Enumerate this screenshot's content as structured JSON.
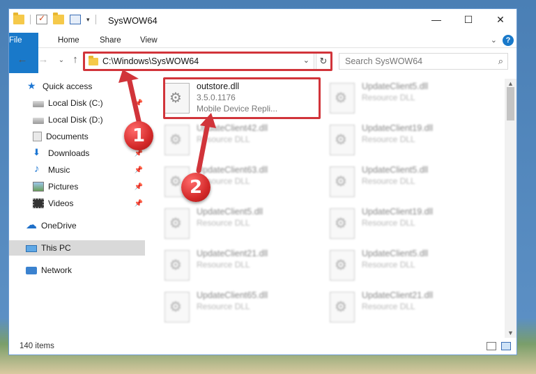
{
  "window": {
    "title": "SysWOW64"
  },
  "ribbon": {
    "tabs": [
      "File",
      "Home",
      "Share",
      "View"
    ]
  },
  "address": {
    "path": "C:\\Windows\\SysWOW64"
  },
  "search": {
    "placeholder": "Search SysWOW64"
  },
  "sidebar": {
    "items": [
      {
        "label": "Quick access",
        "icon": "star-icon"
      },
      {
        "label": "Local Disk (C:)",
        "icon": "disk-icon"
      },
      {
        "label": "Local Disk (D:)",
        "icon": "disk-icon"
      },
      {
        "label": "Documents",
        "icon": "documents-icon"
      },
      {
        "label": "Downloads",
        "icon": "download-icon"
      },
      {
        "label": "Music",
        "icon": "music-icon"
      },
      {
        "label": "Pictures",
        "icon": "pictures-icon"
      },
      {
        "label": "Videos",
        "icon": "videos-icon"
      },
      {
        "label": "OneDrive",
        "icon": "cloud-icon"
      },
      {
        "label": "This PC",
        "icon": "pc-icon"
      },
      {
        "label": "Network",
        "icon": "network-icon"
      }
    ]
  },
  "files": {
    "highlighted": {
      "name": "outstore.dll",
      "version": "3.5.0.1176",
      "description": "Mobile Device Repli..."
    },
    "others": [
      {
        "name": "UpdateClient5.dll",
        "type": "Resource DLL"
      },
      {
        "name": "UpdateClient42.dll",
        "type": "Resource DLL"
      },
      {
        "name": "UpdateClient19.dll",
        "type": "Resource DLL"
      },
      {
        "name": "UpdateClient63.dll",
        "type": "Resource DLL"
      },
      {
        "name": "UpdateClient5.dll",
        "type": "Resource DLL"
      },
      {
        "name": "UpdateClient5.dll",
        "type": "Resource DLL"
      },
      {
        "name": "UpdateClient19.dll",
        "type": "Resource DLL"
      },
      {
        "name": "UpdateClient21.dll",
        "type": "Resource DLL"
      },
      {
        "name": "UpdateClient5.dll",
        "type": "Resource DLL"
      },
      {
        "name": "UpdateClient65.dll",
        "type": "Resource DLL"
      },
      {
        "name": "UpdateClient21.dll",
        "type": "Resource DLL"
      }
    ]
  },
  "status": {
    "count": "140 items"
  },
  "annotations": {
    "marker1": "1",
    "marker2": "2",
    "color": "#d1343a"
  }
}
